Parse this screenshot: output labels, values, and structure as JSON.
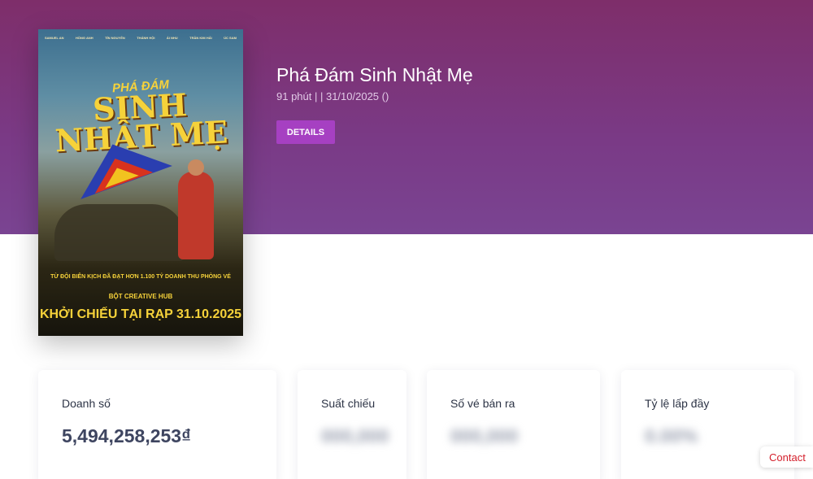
{
  "movie": {
    "title": "Phá Đám Sinh Nhật Mẹ",
    "meta": "91 phút   |    | 31/10/2025 ()",
    "details_label": "DETAILS",
    "poster": {
      "cast": [
        "SAMUEL AN",
        "HỒNG ANH",
        "TÍN NGUYỄN",
        "THÁNH HỘI",
        "ÁI NHU",
        "TRẦN KIM HẢI",
        "ÚC SAM"
      ],
      "title_top": "PHÁ ĐÁM",
      "title_main": "SINH NHẬT MẸ",
      "tagline": "TỪ ĐỘI BIÊN KỊCH ĐÃ ĐẠT HƠN 1.100 TỶ DOANH THU PHÒNG VÉ",
      "studio": "BỘT CREATIVE HUB",
      "release": "KHỞI CHIẾU TẠI RẠP 31.10.2025"
    }
  },
  "stats": [
    {
      "label": "Doanh số",
      "value": "5,494,258,253₫"
    },
    {
      "label": "Suất chiếu",
      "value": "000,000"
    },
    {
      "label": "Số vé bán ra",
      "value": "000,000"
    },
    {
      "label": "Tỷ lệ lấp đầy",
      "value": "0.00%"
    }
  ],
  "contact_label": "Contact"
}
